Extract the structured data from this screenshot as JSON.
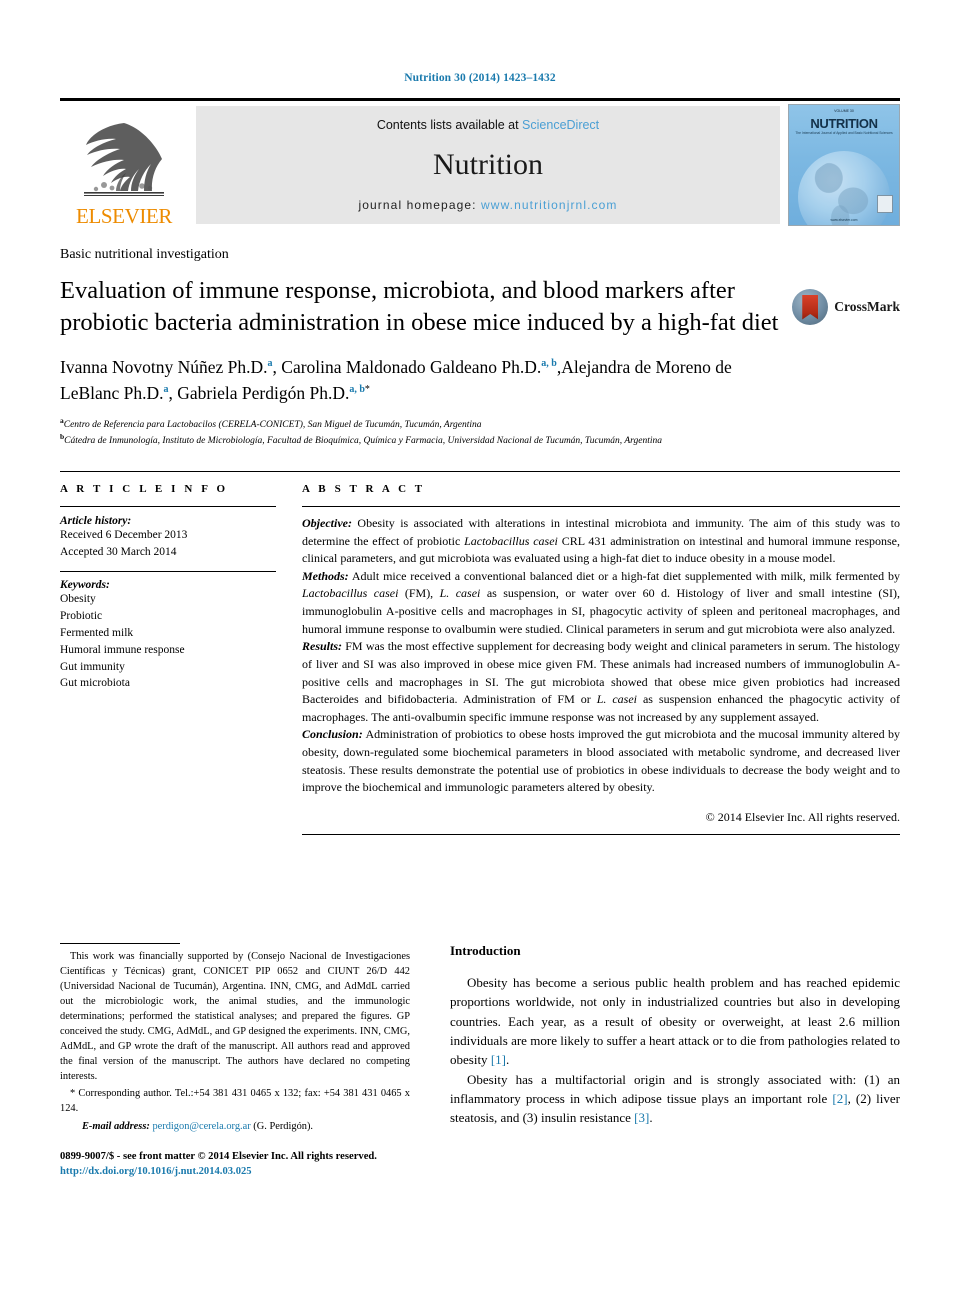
{
  "running_head": "Nutrition 30 (2014) 1423–1432",
  "masthead": {
    "publisher": "ELSEVIER",
    "contents_prefix": "Contents lists available at ",
    "contents_link": "ScienceDirect",
    "journal_name": "Nutrition",
    "homepage_prefix": "journal homepage: ",
    "homepage_url": "www.nutritionjrnl.com",
    "cover": {
      "volume": "VOLUME 30",
      "title": "NUTRITION",
      "subtitle": "The International Journal of Applied and Basic Nutritional Sciences",
      "footer": "www.elsevier.com"
    }
  },
  "article": {
    "section_label": "Basic nutritional investigation",
    "title": "Evaluation of immune response, microbiota, and blood markers after probiotic bacteria administration in obese mice induced by a high-fat diet",
    "crossmark_label": "CrossMark",
    "authors": [
      {
        "name": "Ivanna Novotny Núñez Ph.D.",
        "sup": "a",
        "sep": ", "
      },
      {
        "name": "Carolina Maldonado Galdeano Ph.D.",
        "sup": "a, b",
        "sep": ","
      },
      {
        "name": "Alejandra de Moreno de LeBlanc Ph.D.",
        "sup": "a",
        "sep": ", "
      },
      {
        "name": "Gabriela Perdigón Ph.D.",
        "sup": "a, b",
        "star": "*",
        "sep": ""
      }
    ],
    "affiliations": [
      {
        "mark": "a",
        "text": "Centro de Referencia para Lactobacilos (CERELA-CONICET), San Miguel de Tucumán, Tucumán, Argentina"
      },
      {
        "mark": "b",
        "text": "Cátedra de Inmunología, Instituto de Microbiología, Facultad de Bioquímica, Química y Farmacia, Universidad Nacional de Tucumán, Tucumán, Argentina"
      }
    ]
  },
  "article_info": {
    "kicker": "A R T I C L E    I N F O",
    "history_head": "Article history:",
    "history": [
      "Received 6 December 2013",
      "Accepted 30 March 2014"
    ],
    "keywords_head": "Keywords:",
    "keywords": [
      "Obesity",
      "Probiotic",
      "Fermented milk",
      "Humoral immune response",
      "Gut immunity",
      "Gut microbiota"
    ]
  },
  "abstract": {
    "kicker": "A B S T R A C T",
    "sections": [
      {
        "lead": "Objective:",
        "text": " Obesity is associated with alterations in intestinal microbiota and immunity. The aim of this study was to determine the effect of probiotic Lactobacillus casei CRL 431 administration on intestinal and humoral immune response, clinical parameters, and gut microbiota was evaluated using a high-fat diet to induce obesity in a mouse model."
      },
      {
        "lead": "Methods:",
        "text": " Adult mice received a conventional balanced diet or a high-fat diet supplemented with milk, milk fermented by Lactobacillus casei (FM), L. casei as suspension, or water over 60 d. Histology of liver and small intestine (SI), immunoglobulin A-positive cells and macrophages in SI, phagocytic activity of spleen and peritoneal macrophages, and humoral immune response to ovalbumin were studied. Clinical parameters in serum and gut microbiota were also analyzed."
      },
      {
        "lead": "Results:",
        "text": " FM was the most effective supplement for decreasing body weight and clinical parameters in serum. The histology of liver and SI was also improved in obese mice given FM. These animals had increased numbers of immunoglobulin A-positive cells and macrophages in SI. The gut microbiota showed that obese mice given probiotics had increased Bacteroides and bifidobacteria. Administration of FM or L. casei as suspension enhanced the phagocytic activity of macrophages. The anti-ovalbumin specific immune response was not increased by any supplement assayed."
      },
      {
        "lead": "Conclusion:",
        "text": " Administration of probiotics to obese hosts improved the gut microbiota and the mucosal immunity altered by obesity, down-regulated some biochemical parameters in blood associated with metabolic syndrome, and decreased liver steatosis. These results demonstrate the potential use of probiotics in obese individuals to decrease the body weight and to improve the biochemical and immunologic parameters altered by obesity."
      }
    ],
    "copyright": "© 2014 Elsevier Inc. All rights reserved."
  },
  "footnotes": {
    "funding": "This work was financially supported by (Consejo Nacional de Investigaciones Científicas y Técnicas) grant, CONICET PIP 0652 and CIUNT 26/D 442 (Universidad Nacional de Tucumán), Argentina. INN, CMG, and AdMdL carried out the microbiologic work, the animal studies, and the immunologic determinations; performed the statistical analyses; and prepared the figures. GP conceived the study. CMG, AdMdL, and GP designed the experiments. INN, CMG, AdMdL, and GP wrote the draft of the manuscript. All authors read and approved the final version of the manuscript. The authors have declared no competing interests.",
    "corresponding": "* Corresponding author. Tel.:+54 381 431 0465 x 132; fax: +54 381 431 0465 x 124.",
    "email_label": "E-mail address:",
    "email": "perdigon@cerela.org.ar",
    "email_suffix": " (G. Perdigón)."
  },
  "issn": {
    "line": "0899-9007/$ - see front matter © 2014 Elsevier Inc. All rights reserved.",
    "doi": "http://dx.doi.org/10.1016/j.nut.2014.03.025"
  },
  "introduction": {
    "heading": "Introduction",
    "paragraphs": [
      {
        "text": "Obesity has become a serious public health problem and has reached epidemic proportions worldwide, not only in industrialized countries but also in developing countries. Each year, as a result of obesity or overweight, at least 2.6 million individuals are more likely to suffer a heart attack or to die from pathologies related to obesity ",
        "refs": [
          "[1]"
        ],
        "tail": "."
      },
      {
        "text": "Obesity has a multifactorial origin and is strongly associated with: (1) an inflammatory process in which adipose tissue plays an important role [2], (2) liver steatosis, and (3) insulin resistance [3].",
        "refs": [],
        "tail": ""
      }
    ]
  },
  "colors": {
    "link_blue": "#1a7aad",
    "masthead_link": "#4a9fd4",
    "elsevier_orange": "#ED8B00",
    "banner_grey": "#e6e6e6"
  }
}
